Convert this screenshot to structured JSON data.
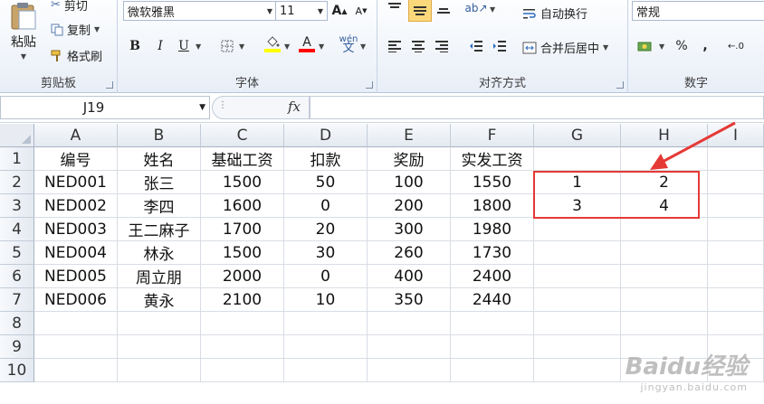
{
  "ribbon": {
    "clipboard": {
      "paste": "粘贴",
      "cut": "剪切",
      "copy": "复制",
      "format_painter": "格式刷",
      "group_label": "剪贴板"
    },
    "font": {
      "font_name": "微软雅黑",
      "font_size": "11",
      "grow": "A",
      "shrink": "A",
      "bold": "B",
      "italic": "I",
      "underline": "U",
      "phonetic": "wén",
      "font_color_letter": "A",
      "group_label": "字体",
      "fill_color": "#ffff00",
      "font_color": "#ff0000"
    },
    "alignment": {
      "wrap_text": "自动换行",
      "merge_center": "合并后居中",
      "group_label": "对齐方式"
    },
    "number": {
      "format": "常规",
      "percent": "%",
      "comma": ",",
      "group_label": "数字"
    }
  },
  "formula_bar": {
    "name_box": "J19",
    "fx": "fx",
    "formula": ""
  },
  "sheet": {
    "columns": [
      "A",
      "B",
      "C",
      "D",
      "E",
      "F",
      "G",
      "H",
      "I"
    ],
    "rows": [
      "1",
      "2",
      "3",
      "4",
      "5",
      "6",
      "7",
      "8",
      "9",
      "10"
    ],
    "cells": [
      [
        "编号",
        "姓名",
        "基础工资",
        "扣款",
        "奖励",
        "实发工资",
        "",
        "",
        ""
      ],
      [
        "NED001",
        "张三",
        "1500",
        "50",
        "100",
        "1550",
        "1",
        "2",
        ""
      ],
      [
        "NED002",
        "李四",
        "1600",
        "0",
        "200",
        "1800",
        "3",
        "4",
        ""
      ],
      [
        "NED003",
        "王二麻子",
        "1700",
        "20",
        "300",
        "1980",
        "",
        "",
        ""
      ],
      [
        "NED004",
        "林永",
        "1500",
        "30",
        "260",
        "1730",
        "",
        "",
        ""
      ],
      [
        "NED005",
        "周立朋",
        "2000",
        "0",
        "400",
        "2400",
        "",
        "",
        ""
      ],
      [
        "NED006",
        "黄永",
        "2100",
        "10",
        "350",
        "2440",
        "",
        "",
        ""
      ],
      [
        "",
        "",
        "",
        "",
        "",
        "",
        "",
        "",
        ""
      ],
      [
        "",
        "",
        "",
        "",
        "",
        "",
        "",
        "",
        ""
      ],
      [
        "",
        "",
        "",
        "",
        "",
        "",
        "",
        "",
        ""
      ]
    ]
  },
  "annotation": {
    "color": "#e53935"
  },
  "watermark": {
    "brand": "Baidu经验",
    "url": "jingyan.baidu.com"
  }
}
